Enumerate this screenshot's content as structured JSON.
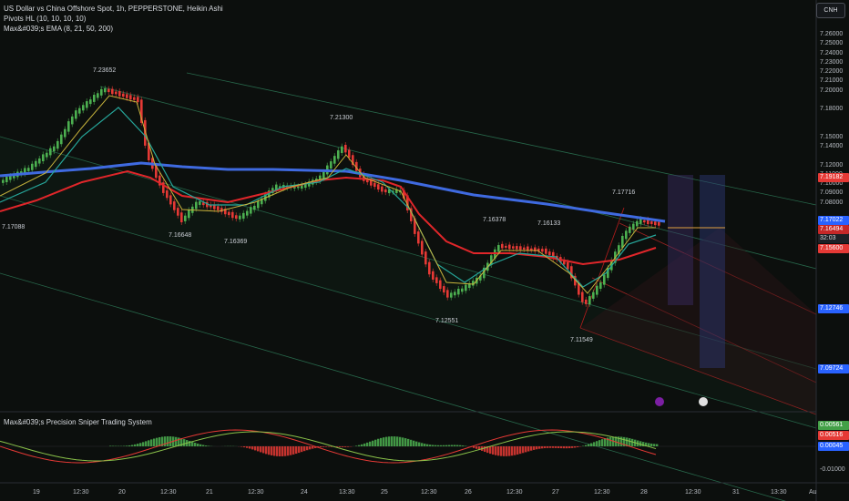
{
  "legend": {
    "symbol_line": "US Dollar vs China Offshore Spot, 1h, PEPPERSTONE, Heikin Ashi",
    "pivots_line": "Pivots HL (10, 10, 10, 10)",
    "ema_line": "Max&#039;s EMA (8, 21, 50, 200)"
  },
  "currency_button": "CNH",
  "oscillator_title": "Max&#039;s Precision Sniper Trading System",
  "price_axis": [
    "7.26000",
    "7.25000",
    "7.24000",
    "7.23000",
    "7.22000",
    "7.21000",
    "7.20000",
    "7.18000",
    "7.15000",
    "7.14000",
    "7.12000",
    "7.11000",
    "7.10000",
    "7.09000",
    "7.08000"
  ],
  "price_tags": [
    {
      "text": "7.19182",
      "bg": "#e53935",
      "color": "#ffffff"
    },
    {
      "text": "7.17022",
      "bg": "#2962ff",
      "color": "#ffffff"
    },
    {
      "text": "7.16494",
      "bg": "#c62828",
      "color": "#ffffff"
    },
    {
      "text": "32:03",
      "bg": "#1e2126",
      "color": "#d6d9de"
    },
    {
      "text": "7.15600",
      "bg": "#e53935",
      "color": "#ffffff"
    },
    {
      "text": "7.12746",
      "bg": "#2962ff",
      "color": "#ffffff"
    },
    {
      "text": "7.09724",
      "bg": "#2962ff",
      "color": "#ffffff"
    }
  ],
  "osc_axis": [
    "0.00561",
    "0.00516",
    "0.00045",
    "-0.01000"
  ],
  "osc_tags_colors": [
    "#43a047",
    "#e53935",
    "#2962ff"
  ],
  "pivots": [
    "7.23652",
    "7.21300",
    "7.17088",
    "7.16648",
    "7.16369",
    "7.12551",
    "7.16378",
    "7.16133",
    "7.17716",
    "7.11549"
  ],
  "dates": [
    "19",
    "12:30",
    "20",
    "12:30",
    "21",
    "12:30",
    "24",
    "13:30",
    "25",
    "12:30",
    "26",
    "12:30",
    "27",
    "12:30",
    "28",
    "12:30",
    "31",
    "13:30",
    "Au"
  ],
  "colors": {
    "bull": "#4caf50",
    "bear": "#e53935",
    "ema200": "#3f6ae0",
    "ema50": "#e0262a",
    "ema21": "#26a69a",
    "ema8": "#c8b43c",
    "channel": "#2e7d5a",
    "redline": "#c62828"
  }
}
